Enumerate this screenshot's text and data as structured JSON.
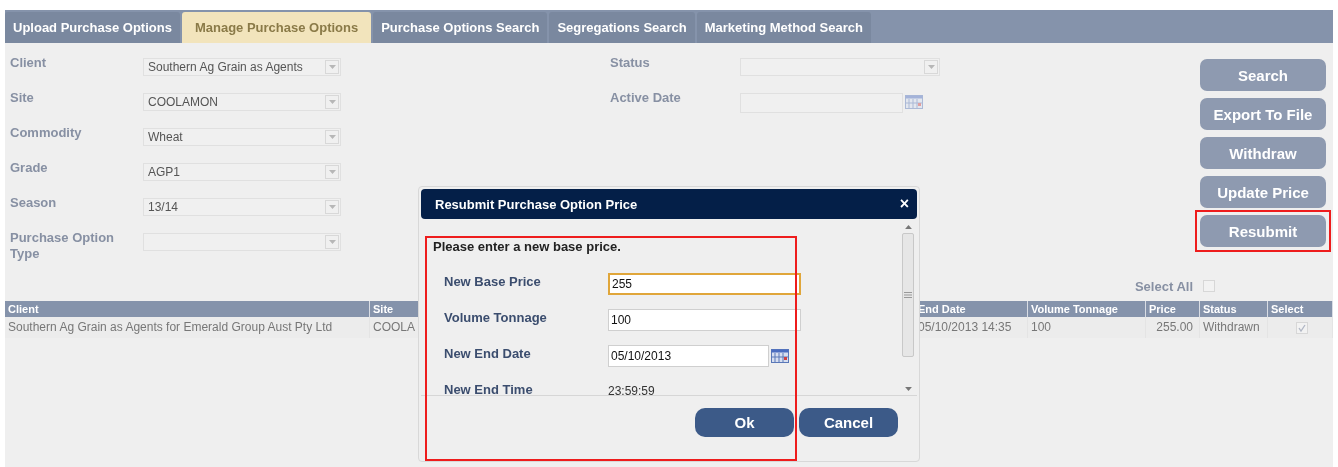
{
  "tabs": [
    {
      "label": "Upload Purchase Options",
      "selected": false
    },
    {
      "label": "Manage Purchase Options",
      "selected": true
    },
    {
      "label": "Purchase Options Search",
      "selected": false
    },
    {
      "label": "Segregations Search",
      "selected": false
    },
    {
      "label": "Marketing Method Search",
      "selected": false
    }
  ],
  "filters": [
    {
      "label": "Client",
      "kind": "select",
      "value": "Southern Ag Grain as Agents"
    },
    {
      "label": "Site",
      "kind": "select",
      "value": "COOLAMON"
    },
    {
      "label": "Commodity",
      "kind": "select",
      "value": "Wheat"
    },
    {
      "label": "Grade",
      "kind": "select",
      "value": "AGP1"
    },
    {
      "label": "Season",
      "kind": "select",
      "value": "13/14"
    },
    {
      "label": "Purchase Option Type",
      "kind": "select"
    }
  ],
  "side_filters": [
    {
      "label": "Status",
      "kind": "select"
    },
    {
      "label": "Active Date",
      "kind": "date"
    }
  ],
  "actions": [
    {
      "label": "Search",
      "highlighted": false
    },
    {
      "label": "Export To File",
      "highlighted": false
    },
    {
      "label": "Withdraw",
      "highlighted": false
    },
    {
      "label": "Update Price",
      "highlighted": false
    },
    {
      "label": "Resubmit",
      "highlighted": true
    }
  ],
  "select_all": {
    "label": "Select All",
    "checked": false
  },
  "table": {
    "columns": [
      "Client",
      "Site",
      "End Date",
      "Volume Tonnage",
      "Price",
      "Status",
      "Select"
    ],
    "rows": [
      {
        "cells": [
          "Southern Ag Grain as Agents for Emerald Group Aust Pty Ltd",
          "COOLA",
          "05/10/2013 14:35",
          "100",
          "255.00",
          "Withdrawn"
        ],
        "selected": true
      }
    ]
  },
  "dialog": {
    "title": "Resubmit Purchase Option Price",
    "close": "×",
    "highlighted": true,
    "prompt": "Please enter a new base price.",
    "fields": [
      {
        "label": "New Base Price",
        "kind": "input",
        "value": "255",
        "focused": true
      },
      {
        "label": "Volume Tonnage",
        "kind": "input",
        "value": "100",
        "focused": false
      },
      {
        "label": "New End Date",
        "kind": "date",
        "value": "05/10/2013",
        "focused": false
      },
      {
        "label": "New End Time",
        "kind": "text",
        "value": "23:59:59"
      }
    ],
    "buttons": [
      "Ok",
      "Cancel"
    ]
  }
}
